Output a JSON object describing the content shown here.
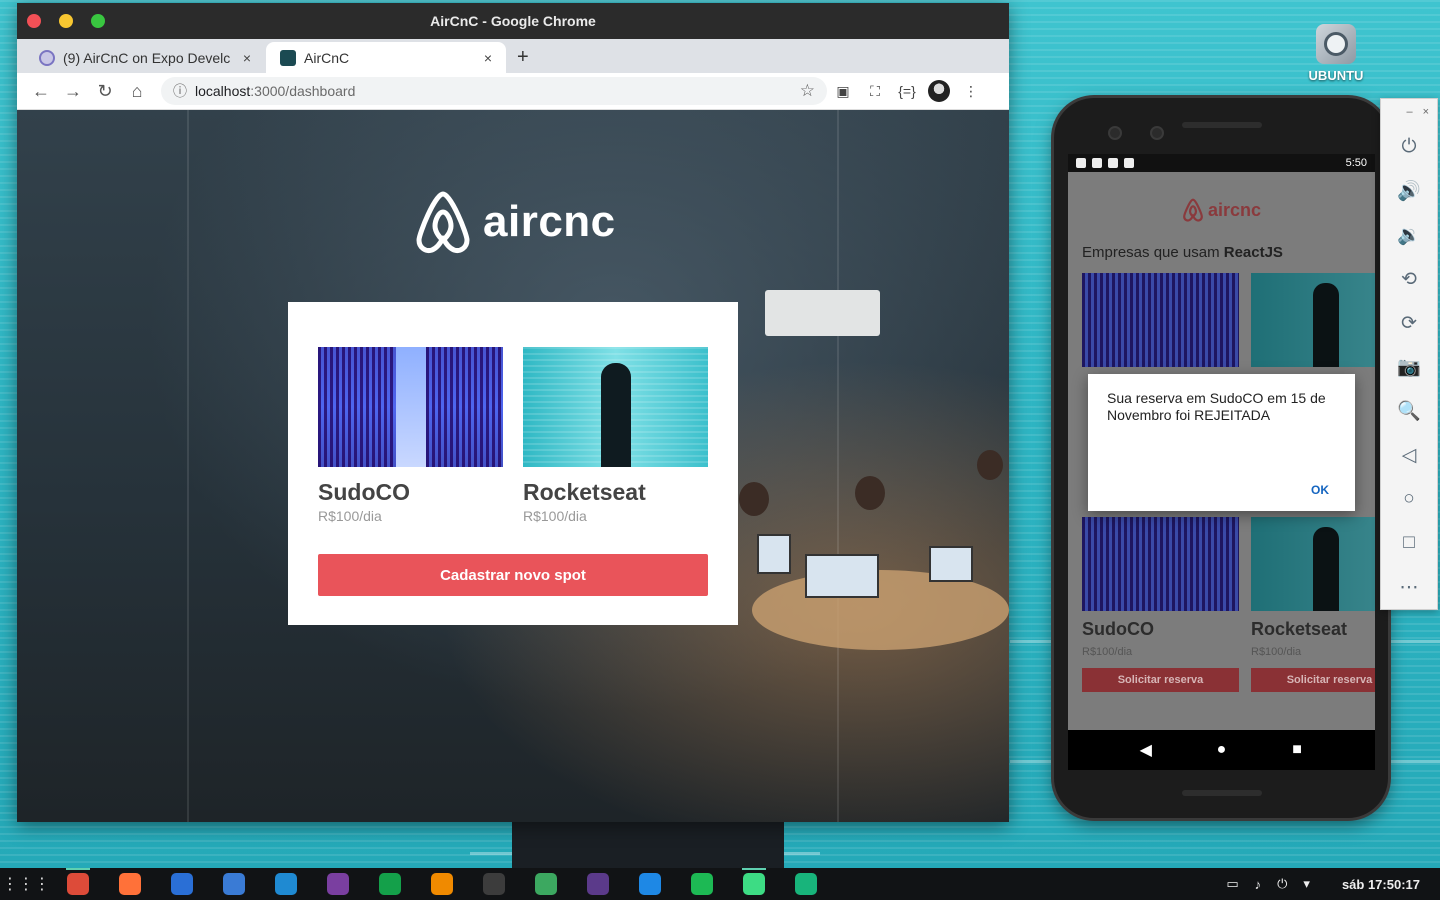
{
  "desktop": {
    "icon_label": "UBUNTU"
  },
  "chrome": {
    "window_title": "AirCnC - Google Chrome",
    "tabs": [
      {
        "label": "(9) AirCnC on Expo Develc",
        "close": "×"
      },
      {
        "label": "AirCnC",
        "close": "×"
      }
    ],
    "new_tab": "+",
    "url_host": "localhost",
    "url_path": ":3000/dashboard",
    "nav": {
      "back": "←",
      "forward": "→",
      "reload": "↻",
      "home": "⌂"
    },
    "star": "☆",
    "ext_json": "{=}",
    "menu": "⋮"
  },
  "page": {
    "logo_text": "aircnc",
    "spots": [
      {
        "name": "SudoCO",
        "price": "R$100/dia",
        "image": "server-room"
      },
      {
        "name": "Rocketseat",
        "price": "R$100/dia",
        "image": "glitch-silhouette"
      }
    ],
    "cta_label": "Cadastrar novo spot"
  },
  "phone": {
    "time": "5:50",
    "app_logo": "aircnc",
    "section_prefix": "Empresas que usam ",
    "section_tech": "ReactJS",
    "cards": [
      {
        "name": "SudoCO",
        "price": "R$100/dia",
        "button": "Solicitar reserva"
      },
      {
        "name": "Rocketseat",
        "price": "R$100/dia",
        "button": "Solicitar reserva"
      }
    ],
    "dialog": {
      "message": "Sua reserva em SudoCO em 15 de Novembro foi REJEITADA",
      "ok": "OK"
    },
    "nav": {
      "back": "◀",
      "home": "●",
      "recents": "■"
    }
  },
  "emulator_toolbar": {
    "minimize": "–",
    "close": "×",
    "buttons": [
      "power-icon",
      "volume-up-icon",
      "volume-down-icon",
      "rotate-left-icon",
      "rotate-right-icon",
      "camera-icon",
      "zoom-icon",
      "back-icon",
      "home-icon",
      "overview-icon",
      "more-icon"
    ],
    "glyphs": [
      "⏻",
      "🔊",
      "🔉",
      "⟲",
      "⟳",
      "📷",
      "🔍",
      "◁",
      "○",
      "□",
      "⋯"
    ]
  },
  "taskbar": {
    "clock": "sáb 17:50:17",
    "apps": [
      {
        "name": "chrome",
        "color": "#dd4b39"
      },
      {
        "name": "firefox",
        "color": "#ff7139"
      },
      {
        "name": "files",
        "color": "#2a6fd6"
      },
      {
        "name": "flameshot",
        "color": "#3a7bd5"
      },
      {
        "name": "vscode",
        "color": "#1f8ad2"
      },
      {
        "name": "insomnia",
        "color": "#7a3fa0"
      },
      {
        "name": "mongodb-compass",
        "color": "#14a04a"
      },
      {
        "name": "vlc",
        "color": "#f08a00"
      },
      {
        "name": "terminal",
        "color": "#3c3c3c"
      },
      {
        "name": "cloud",
        "color": "#3ca860"
      },
      {
        "name": "video-editor",
        "color": "#5b3a8a"
      },
      {
        "name": "screenshot",
        "color": "#1e88e5"
      },
      {
        "name": "spotify",
        "color": "#1db954"
      },
      {
        "name": "android-studio",
        "color": "#3ddc84"
      },
      {
        "name": "app-green",
        "color": "#18b47b"
      }
    ]
  },
  "colors": {
    "brand": "#e9545a",
    "desktop": "#2ab4c2",
    "dialog_ok": "#1565c0"
  }
}
